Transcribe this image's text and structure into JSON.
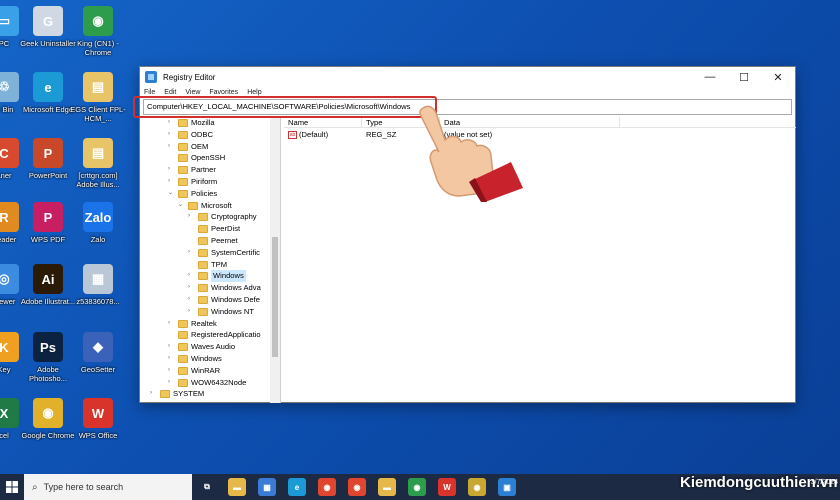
{
  "desktop": {
    "icons": [
      {
        "label": "PC",
        "color": "#3aa0e8",
        "glyph": "▭"
      },
      {
        "label": "le Bin",
        "color": "#7fb2d8",
        "glyph": "♲"
      },
      {
        "label": "aner",
        "color": "#d84a2f",
        "glyph": "C"
      },
      {
        "label": "Reader",
        "color": "#e08a20",
        "glyph": "R"
      },
      {
        "label": "Viewer",
        "color": "#3b8be0",
        "glyph": "◎"
      },
      {
        "label": "Key",
        "color": "#f0a020",
        "glyph": "K"
      },
      {
        "label": "cel",
        "color": "#1f7a45",
        "glyph": "X"
      },
      {
        "label": "Geek Uninstaller",
        "color": "#cfd8e3",
        "glyph": "G"
      },
      {
        "label": "Microsoft Edge",
        "color": "#1b9ad6",
        "glyph": "e"
      },
      {
        "label": "PowerPoint",
        "color": "#c8482a",
        "glyph": "P"
      },
      {
        "label": "WPS PDF",
        "color": "#c81e62",
        "glyph": "P"
      },
      {
        "label": "Adobe Illustrat...",
        "color": "#2b1a05",
        "glyph": "Ai"
      },
      {
        "label": "Adobe Photosho...",
        "color": "#0b2340",
        "glyph": "Ps"
      },
      {
        "label": "Google Chrome",
        "color": "#e1b12c",
        "glyph": "◉"
      },
      {
        "label": "King (CN1) - Chrome",
        "color": "#2e9c4d",
        "glyph": "◉"
      },
      {
        "label": "EGS Client FPL-HCM_...",
        "color": "#e6c467",
        "glyph": "▤"
      },
      {
        "label": "[crttgn.com] Adobe Illus...",
        "color": "#e6c467",
        "glyph": "▤"
      },
      {
        "label": "Zalo",
        "color": "#1a73e8",
        "glyph": "Zalo"
      },
      {
        "label": "z53836078...",
        "color": "#b9c7d6",
        "glyph": "▦"
      },
      {
        "label": "GeoSetter",
        "color": "#3a62b8",
        "glyph": "◆"
      },
      {
        "label": "WPS Office",
        "color": "#d9342b",
        "glyph": "W"
      }
    ]
  },
  "window": {
    "title": "Registry Editor",
    "controls": {
      "minimize": "—",
      "maximize": "☐",
      "close": "✕"
    },
    "menu": [
      "File",
      "Edit",
      "View",
      "Favorites",
      "Help"
    ],
    "address": "Computer\\HKEY_LOCAL_MACHINE\\SOFTWARE\\Policies\\Microsoft\\Windows",
    "tree": [
      {
        "label": "Mozilla",
        "depth": 1,
        "chev": "›"
      },
      {
        "label": "ODBC",
        "depth": 1,
        "chev": "›"
      },
      {
        "label": "OEM",
        "depth": 1,
        "chev": "›"
      },
      {
        "label": "OpenSSH",
        "depth": 1,
        "chev": ""
      },
      {
        "label": "Partner",
        "depth": 1,
        "chev": "›"
      },
      {
        "label": "Piriform",
        "depth": 1,
        "chev": "›"
      },
      {
        "label": "Policies",
        "depth": 1,
        "chev": "⌄"
      },
      {
        "label": "Microsoft",
        "depth": 2,
        "chev": "⌄"
      },
      {
        "label": "Cryptography",
        "depth": 3,
        "chev": "›"
      },
      {
        "label": "PeerDist",
        "depth": 3,
        "chev": ""
      },
      {
        "label": "Peernet",
        "depth": 3,
        "chev": ""
      },
      {
        "label": "SystemCertific",
        "depth": 3,
        "chev": "›"
      },
      {
        "label": "TPM",
        "depth": 3,
        "chev": ""
      },
      {
        "label": "Windows",
        "depth": 3,
        "chev": "›",
        "selected": true
      },
      {
        "label": "Windows Adva",
        "depth": 3,
        "chev": "›"
      },
      {
        "label": "Windows Defe",
        "depth": 3,
        "chev": "›"
      },
      {
        "label": "Windows NT",
        "depth": 3,
        "chev": "›"
      },
      {
        "label": "Realtek",
        "depth": 1,
        "chev": "›"
      },
      {
        "label": "RegisteredApplicatio",
        "depth": 1,
        "chev": ""
      },
      {
        "label": "Waves Audio",
        "depth": 1,
        "chev": "›"
      },
      {
        "label": "Windows",
        "depth": 1,
        "chev": "›"
      },
      {
        "label": "WinRAR",
        "depth": 1,
        "chev": "›"
      },
      {
        "label": "WOW6432Node",
        "depth": 1,
        "chev": "›"
      },
      {
        "label": "SYSTEM",
        "depth": 0,
        "chev": "›"
      }
    ],
    "columns": [
      "Name",
      "Type",
      "Data"
    ],
    "values": [
      {
        "name": "(Default)",
        "type": "REG_SZ",
        "data": "(value not set)"
      }
    ]
  },
  "taskbar": {
    "search_placeholder": "Type here to search",
    "apps": [
      {
        "name": "task-view",
        "color": "#1d2a44",
        "glyph": "⧉"
      },
      {
        "name": "file-explorer",
        "color": "#e6b84a",
        "glyph": "▬"
      },
      {
        "name": "store",
        "color": "#3a7bd5",
        "glyph": "▦"
      },
      {
        "name": "edge",
        "color": "#1b9ad6",
        "glyph": "e"
      },
      {
        "name": "chrome",
        "color": "#e0462f",
        "glyph": "◉"
      },
      {
        "name": "chrome-profile",
        "color": "#e0462f",
        "glyph": "◉"
      },
      {
        "name": "files",
        "color": "#e6b84a",
        "glyph": "▬"
      },
      {
        "name": "chrome-alt",
        "color": "#2e9c4d",
        "glyph": "◉"
      },
      {
        "name": "wps",
        "color": "#d9342b",
        "glyph": "W"
      },
      {
        "name": "chrome-3",
        "color": "#c8a830",
        "glyph": "◉"
      },
      {
        "name": "regedit",
        "color": "#2d7fd3",
        "glyph": "▣"
      }
    ],
    "watermark": "Kiemdongcuuthien.vn",
    "clock_time": "",
    "clock_date": "3/7/2024"
  },
  "colors": {
    "highlight": "#d32f2f",
    "selection": "#cce8ff",
    "desktop": "#1565c8"
  }
}
